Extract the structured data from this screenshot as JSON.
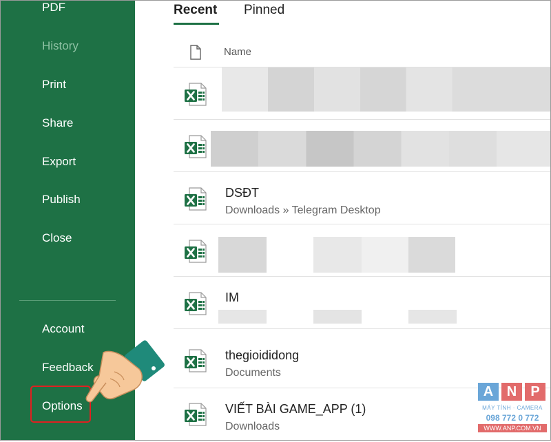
{
  "sidebar": {
    "items": [
      {
        "label": "PDF",
        "dim": false
      },
      {
        "label": "History",
        "dim": true
      },
      {
        "label": "Print",
        "dim": false
      },
      {
        "label": "Share",
        "dim": false
      },
      {
        "label": "Export",
        "dim": false
      },
      {
        "label": "Publish",
        "dim": false
      },
      {
        "label": "Close",
        "dim": false
      }
    ],
    "bottom_items": [
      {
        "label": "Account"
      },
      {
        "label": "Feedback"
      },
      {
        "label": "Options"
      }
    ]
  },
  "tabs": [
    {
      "label": "Recent",
      "active": true
    },
    {
      "label": "Pinned",
      "active": false
    }
  ],
  "header": {
    "name_label": "Name"
  },
  "files": [
    {
      "name": "",
      "path": "",
      "redacted": true
    },
    {
      "name": "",
      "path": "",
      "redacted": true
    },
    {
      "name": "DSĐT",
      "path": "Downloads » Telegram Desktop",
      "redacted": false
    },
    {
      "name": "",
      "path": "",
      "redacted": true
    },
    {
      "name": "IM",
      "path": "",
      "redacted": true
    },
    {
      "name": "thegioididong",
      "path": "Documents",
      "redacted": false
    },
    {
      "name": "VIẾT BÀI GAME_APP (1)",
      "path": "Downloads",
      "redacted": false
    }
  ],
  "watermark": {
    "letters": [
      "A",
      "N",
      "P"
    ],
    "subtitle": "MÁY TÍNH · CAMERA",
    "phone": "098 772 0 772",
    "website": "WWW.ANP.COM.VN"
  },
  "colors": {
    "sidebar_bg": "#1e7145",
    "excel_green": "#1e7145",
    "highlight_red": "#e02020"
  }
}
